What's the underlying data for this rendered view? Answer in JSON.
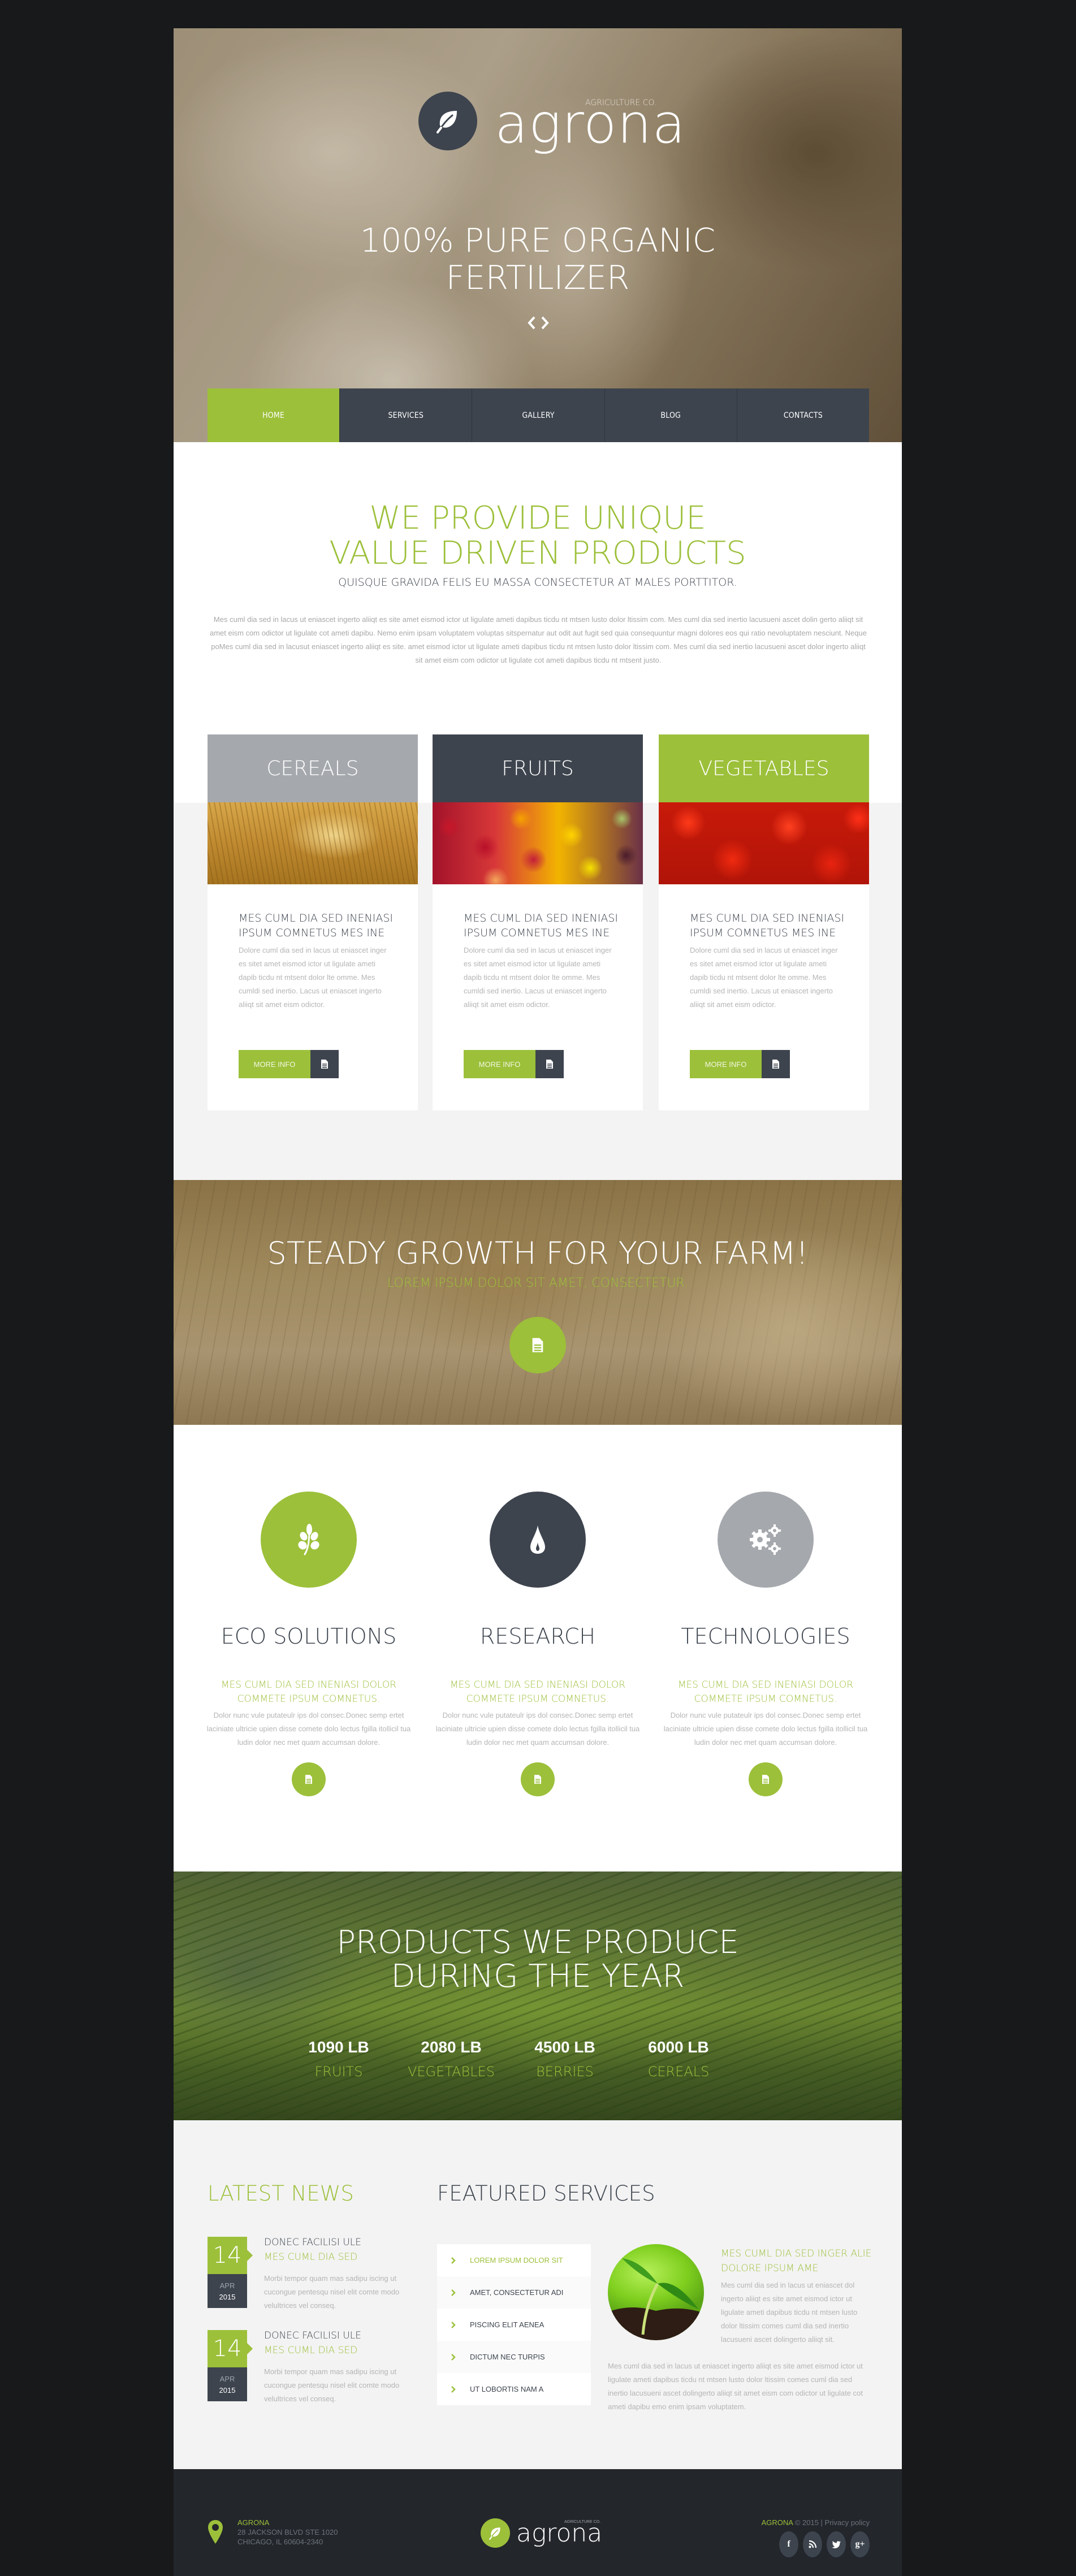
{
  "colors": {
    "accent": "#9cc03a",
    "dark": "#3d444e",
    "grey": "#a5a8ad",
    "footer": "#23262b",
    "background": "#18191b"
  },
  "header": {
    "logo_tagline": "AGRICULTURE CO.",
    "logo_name": "agrona",
    "logo_icon": "leaf-icon",
    "hero_title_line1": "100% PURE ORGANIC",
    "hero_title_line2": "FERTILIZER",
    "slider_icons": [
      "chevron-left-icon",
      "chevron-right-icon"
    ]
  },
  "nav": {
    "items": [
      {
        "label": "HOME",
        "active": true
      },
      {
        "label": "SERVICES",
        "active": false
      },
      {
        "label": "GALLERY",
        "active": false
      },
      {
        "label": "BLOG",
        "active": false
      },
      {
        "label": "CONTACTS",
        "active": false
      }
    ]
  },
  "intro": {
    "title_line1": "WE PROVIDE UNIQUE",
    "title_line2": "VALUE DRIVEN PRODUCTS",
    "subtitle": "QUISQUE GRAVIDA FELIS EU MASSA CONSECTETUR AT MALES PORTTITOR.",
    "text": "Mes cuml dia sed in lacus ut eniascet ingerto aliiqt es site amet eismod ictor ut ligulate ameti dapibus ticdu nt mtsen lusto dolor ltissim com. Mes cuml dia sed inertio lacusueni ascet dolin gerto aliiqt sit amet eism com odictor ut ligulate cot ameti dapibu. Nemo enim ipsam voluptatem voluptas sitspernatur aut odit aut fugit sed quia consequuntur magni dolores eos qui ratio nevoluptatem nesciunt. Neque poMes cuml dia sed in lacusut eniascet ingerto aliiqt es site. amet eismod ictor ut ligulate ameti dapibus ticdu nt mtsen lusto dolor ltissim com. Mes cuml dia sed inertio lacusueni ascet dolor ingerto aliiqt sit amet eism com odictor ut ligulate cot ameti dapibus ticdu nt mtsent justo."
  },
  "cards": [
    {
      "heading": "CEREALS",
      "image": "wheat-photo",
      "title": "MES CUML DIA SED INENIASI IPSUM COMNETUS MES INE",
      "text": "Dolore cuml dia sed in lacus ut eniascet inger es sitet amet eismod ictor ut ligulate ameti dapib ticdu nt mtsent dolor lte omme. Mes cumldi sed inertio. Lacus ut eniascet ingerto aliiqt sit amet eism odictor.",
      "button": "MORE INFO"
    },
    {
      "heading": "FRUITS",
      "image": "fruits-photo",
      "title": "MES CUML DIA SED INENIASI IPSUM COMNETUS MES INE",
      "text": "Dolore cuml dia sed in lacus ut eniascet inger es sitet amet eismod ictor ut ligulate ameti dapib ticdu nt mtsent dolor lte omme. Mes cumldi sed inertio. Lacus ut eniascet ingerto aliiqt sit amet eism odictor.",
      "button": "MORE INFO"
    },
    {
      "heading": "VEGETABLES",
      "image": "tomatoes-photo",
      "title": "MES CUML DIA SED INENIASI IPSUM COMNETUS MES INE",
      "text": "Dolore cuml dia sed in lacus ut eniascet inger es sitet amet eismod ictor ut ligulate ameti dapib ticdu nt mtsent dolor lte omme. Mes cumldi sed inertio. Lacus ut eniascet ingerto aliiqt sit amet eism odictor.",
      "button": "MORE INFO"
    }
  ],
  "growth": {
    "title": "STEADY GROWTH FOR YOUR FARM!",
    "subtitle": "LOREM IPSUM DOLOR SIT AMET, CONSECTETUR.",
    "button_icon": "document-icon"
  },
  "features": [
    {
      "icon": "plant-sprout-icon",
      "title": "ECO SOLUTIONS",
      "subtitle": "MES CUML DIA SED INENIASI DOLOR COMMETE IPSUM COMNETUS.",
      "text": "Dolor nunc vule putateulr ips dol consec.Donec semp ertet laciniate ultricie upien disse comete dolo lectus fgilla itollicil tua ludin dolor nec met quam accumsan dolore."
    },
    {
      "icon": "water-drop-icon",
      "title": "RESEARCH",
      "subtitle": "MES CUML DIA SED INENIASI DOLOR COMMETE IPSUM COMNETUS.",
      "text": "Dolor nunc vule putateulr ips dol consec.Donec semp ertet laciniate ultricie upien disse comete dolo lectus fgilla itollicil tua ludin dolor nec met quam accumsan dolore."
    },
    {
      "icon": "gears-icon",
      "title": "TECHNOLOGIES",
      "subtitle": "MES CUML DIA SED INENIASI DOLOR COMMETE IPSUM COMNETUS.",
      "text": "Dolor nunc vule putateulr ips dol consec.Donec semp ertet laciniate ultricie upien disse comete dolo lectus fgilla itollicil tua ludin dolor nec met quam accumsan dolore."
    }
  ],
  "stats": {
    "title_line1": "PRODUCTS WE PRODUCE",
    "title_line2": "DURING THE YEAR",
    "items": [
      {
        "value": "1090 LB",
        "label": "FRUITS"
      },
      {
        "value": "2080 LB",
        "label": "VEGETABLES"
      },
      {
        "value": "4500 LB",
        "label": "BERRIES"
      },
      {
        "value": "6000 LB",
        "label": "CEREALS"
      }
    ]
  },
  "news": {
    "title": "LATEST NEWS",
    "items": [
      {
        "day": "14",
        "month": "APR",
        "year": "2015",
        "title": "DONEC FACILISI ULE",
        "subtitle": "MES CUML DIA SED",
        "text": "Morbi tempor quam mas sadipu iscing ut cucongue pentesqu nisel elit comte modo velultrices vel conseq."
      },
      {
        "day": "14",
        "month": "APR",
        "year": "2015",
        "title": "DONEC FACILISI ULE",
        "subtitle": "MES CUML DIA SED",
        "text": "Morbi tempor quam mas sadipu iscing ut cucongue pentesqu nisel elit comte modo velultrices vel conseq."
      }
    ]
  },
  "services": {
    "title": "FEATURED SERVICES",
    "list": [
      {
        "label": "LOREM IPSUM DOLOR SIT",
        "active": true
      },
      {
        "label": "AMET, CONSECTETUR ADI",
        "active": false
      },
      {
        "label": "PISCING ELIT AENEA",
        "active": false
      },
      {
        "label": "DICTUM NEC TURPIS",
        "active": false
      },
      {
        "label": "UT LOBORTIS NAM A",
        "active": false
      }
    ],
    "heading": "MES CUML DIA SED INGER ALIE DOLORE IPSUM AME",
    "text1": "Mes cuml dia sed in lacus ut eniascet dol ingerto aliiqt es site amet eismod ictor ut ligulate ameti dapibus ticdu nt mtsen lusto dolor ltissim comes cuml dia sed inertio lacusueni ascet dolingerto aliiqt sit.",
    "text2": "Mes cuml dia sed in lacus ut eniascet ingerto aliiqt es site amet eismod ictor ut ligulate ameti dapibus ticdu nt mtsen lusto dolor ltissim comes cuml dia sed inertio lacusueni ascet dolingerto aliiqt sit amet eism com odictor ut ligulate cot ameti dapibu emo enim ipsam voluptatem."
  },
  "footer": {
    "address_brand": "AGRONA",
    "address_line1": "28 JACKSON BLVD STE 1020",
    "address_line2": "CHICAGO, IL 60604-2340",
    "logo_tagline": "AGRICULTURE CO.",
    "logo_name": "agrona",
    "copyright_brand": "AGRONA",
    "copyright_text": " © 2015 | ",
    "privacy_link": "Privacy policy",
    "social": [
      {
        "icon": "facebook-icon",
        "glyph": "f"
      },
      {
        "icon": "rss-icon",
        "glyph": "∷"
      },
      {
        "icon": "twitter-icon",
        "glyph": "t"
      },
      {
        "icon": "google-plus-icon",
        "glyph": "g+"
      }
    ]
  }
}
